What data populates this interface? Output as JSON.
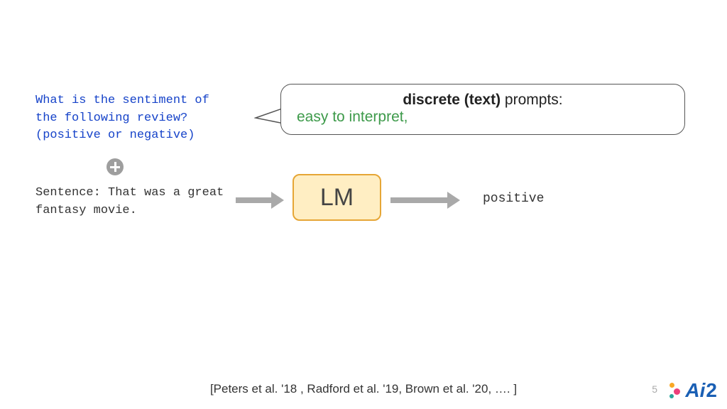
{
  "prompt": "What is the sentiment of the following review? (positive or negative)",
  "sentence": "Sentence: That was a great fantasy movie.",
  "callout": {
    "title_bold": "discrete (text)",
    "title_rest": " prompts:",
    "subtitle": "easy to interpret,"
  },
  "lm_label": "LM",
  "output": "positive",
  "citation": "[Peters et al. '18 , Radford et al. '19, Brown et al. '20, …. ]",
  "page_number": "5",
  "logo_text": "Ai",
  "logo_suffix": "2"
}
